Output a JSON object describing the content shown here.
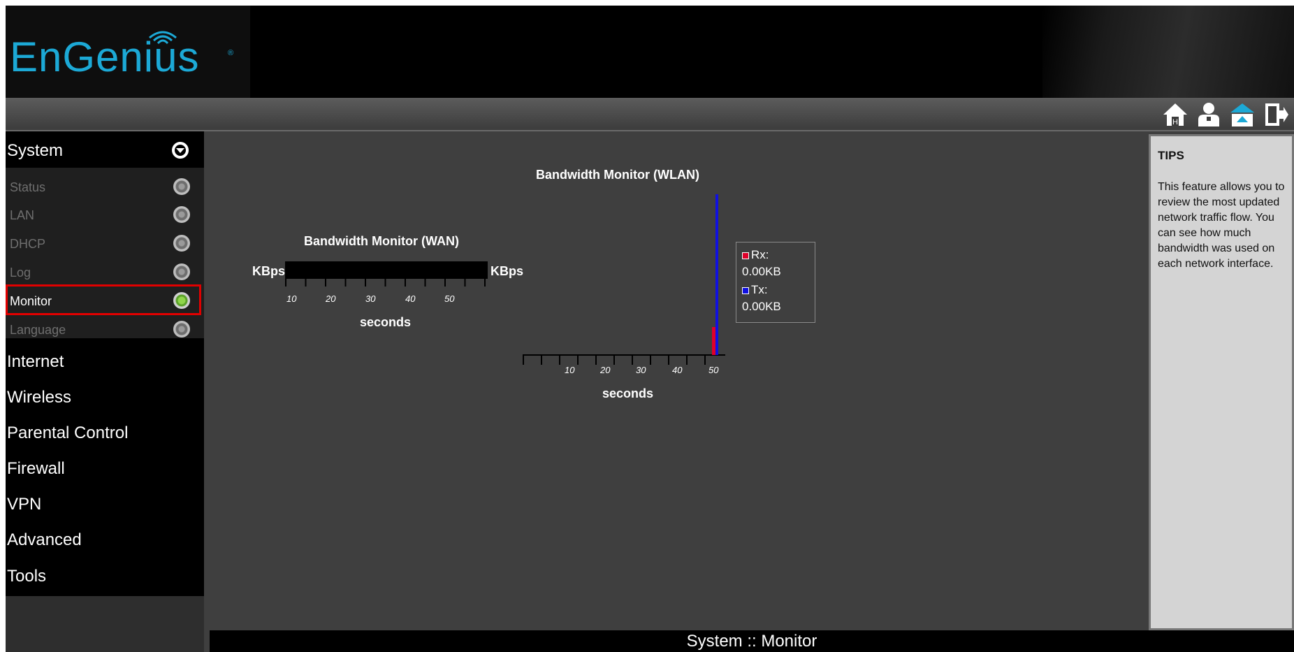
{
  "brand": {
    "logo_text": "EnGenius",
    "logo_reg": "®"
  },
  "toolbar": {
    "icons": [
      "home-icon",
      "user-icon",
      "wizard-icon",
      "logout-icon"
    ]
  },
  "sidebar": {
    "section": {
      "label": "System",
      "icon": "collapse-icon"
    },
    "sub_items": [
      {
        "label": "Status"
      },
      {
        "label": "LAN"
      },
      {
        "label": "DHCP"
      },
      {
        "label": "Log"
      },
      {
        "label": "Monitor",
        "active": true
      },
      {
        "label": "Language"
      }
    ],
    "items": [
      {
        "label": "Internet"
      },
      {
        "label": "Wireless"
      },
      {
        "label": "Parental Control"
      },
      {
        "label": "Firewall"
      },
      {
        "label": "VPN"
      },
      {
        "label": "Advanced"
      },
      {
        "label": "Tools"
      }
    ]
  },
  "chart_data": [
    {
      "type": "bar",
      "title": "Bandwidth Monitor (WAN)",
      "ylabel": "KBps",
      "ylabel_right": "KBps",
      "xlabel": "seconds",
      "x_ticks": [
        "10",
        "20",
        "30",
        "40",
        "50"
      ],
      "series": []
    },
    {
      "type": "bar",
      "title": "Bandwidth Monitor (WLAN)",
      "xlabel": "seconds",
      "x_ticks": [
        "10",
        "20",
        "30",
        "40",
        "50"
      ],
      "series": [
        {
          "name": "Rx:",
          "value_label": "0.00KB",
          "color": "#e0002a"
        },
        {
          "name": "Tx:",
          "value_label": "0.00KB",
          "color": "#1010e0"
        }
      ]
    }
  ],
  "tips": {
    "title": "TIPS",
    "body": "This feature allows you to review the most updated network traffic flow. You can see how much bandwidth was used on each network interface."
  },
  "footer": {
    "title": "System :: Monitor"
  },
  "colors": {
    "accent": "#1ca9d6",
    "highlight": "#e10000",
    "active_dot": "#8fd64a"
  }
}
